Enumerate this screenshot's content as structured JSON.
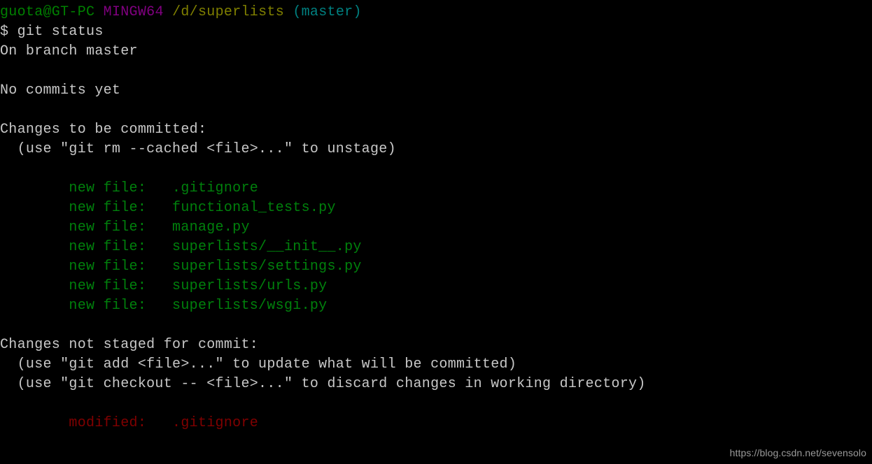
{
  "window": {
    "background_color": "#000000",
    "default_text_color": "#c8c8c8",
    "shell": "MINGW64"
  },
  "palette": {
    "user": "#008000",
    "host": "#800080",
    "path": "#808000",
    "branch": "#008080",
    "default": "#c8c8c8",
    "added": "#00800c",
    "removed": "#800000",
    "watermark": "#9a9a9a"
  },
  "prompt": {
    "user_host": "guota@GT-PC",
    "shell_name": "MINGW64",
    "path": "/d/superlists",
    "branch": "(master)",
    "sigil": "$",
    "command": "git status"
  },
  "lines": [
    {
      "id": "prompt-line",
      "segments": [
        {
          "text": "guota@GT-PC",
          "color": "user"
        },
        {
          "text": " ",
          "color": "default"
        },
        {
          "text": "MINGW64",
          "color": "host"
        },
        {
          "text": " ",
          "color": "default"
        },
        {
          "text": "/d/superlists",
          "color": "path"
        },
        {
          "text": " ",
          "color": "default"
        },
        {
          "text": "(master)",
          "color": "branch"
        }
      ]
    },
    {
      "id": "command-line",
      "segments": [
        {
          "text": "$ git status",
          "color": "default"
        }
      ]
    },
    {
      "id": "branch-status",
      "segments": [
        {
          "text": "On branch master",
          "color": "default"
        }
      ]
    },
    {
      "id": "blank-1",
      "segments": [
        {
          "text": " ",
          "color": "default"
        }
      ]
    },
    {
      "id": "no-commits",
      "segments": [
        {
          "text": "No commits yet",
          "color": "default"
        }
      ]
    },
    {
      "id": "blank-2",
      "segments": [
        {
          "text": " ",
          "color": "default"
        }
      ]
    },
    {
      "id": "staged-header",
      "segments": [
        {
          "text": "Changes to be committed:",
          "color": "default"
        }
      ]
    },
    {
      "id": "staged-hint",
      "segments": [
        {
          "text": "  (use ″git rm --cached <file>...″ to unstage)",
          "color": "default"
        }
      ]
    },
    {
      "id": "blank-3",
      "segments": [
        {
          "text": " ",
          "color": "default"
        }
      ]
    },
    {
      "id": "staged-gitignore",
      "segments": [
        {
          "text": "        new file:   .gitignore",
          "color": "added"
        }
      ]
    },
    {
      "id": "staged-functional-tests",
      "segments": [
        {
          "text": "        new file:   functional_tests.py",
          "color": "added"
        }
      ]
    },
    {
      "id": "staged-manage",
      "segments": [
        {
          "text": "        new file:   manage.py",
          "color": "added"
        }
      ]
    },
    {
      "id": "staged-init",
      "segments": [
        {
          "text": "        new file:   superlists/__init__.py",
          "color": "added"
        }
      ]
    },
    {
      "id": "staged-settings",
      "segments": [
        {
          "text": "        new file:   superlists/settings.py",
          "color": "added"
        }
      ]
    },
    {
      "id": "staged-urls",
      "segments": [
        {
          "text": "        new file:   superlists/urls.py",
          "color": "added"
        }
      ]
    },
    {
      "id": "staged-wsgi",
      "segments": [
        {
          "text": "        new file:   superlists/wsgi.py",
          "color": "added"
        }
      ]
    },
    {
      "id": "blank-4",
      "segments": [
        {
          "text": " ",
          "color": "default"
        }
      ]
    },
    {
      "id": "unstaged-header",
      "segments": [
        {
          "text": "Changes not staged for commit:",
          "color": "default"
        }
      ]
    },
    {
      "id": "unstaged-hint-add",
      "segments": [
        {
          "text": "  (use ″git add <file>...″ to update what will be committed)",
          "color": "default"
        }
      ]
    },
    {
      "id": "unstaged-hint-checkout",
      "segments": [
        {
          "text": "  (use ″git checkout -- <file>...″ to discard changes in working directory)",
          "color": "default"
        }
      ]
    },
    {
      "id": "blank-5",
      "segments": [
        {
          "text": " ",
          "color": "default"
        }
      ]
    },
    {
      "id": "unstaged-gitignore",
      "segments": [
        {
          "text": "        modified:   .gitignore",
          "color": "removed"
        }
      ]
    }
  ],
  "watermark": {
    "text": "https://blog.csdn.net/sevensolo"
  }
}
